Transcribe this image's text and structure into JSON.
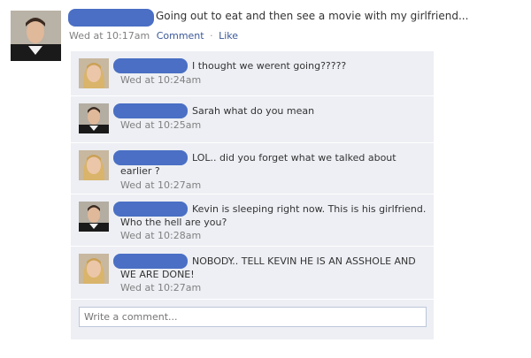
{
  "post": {
    "text": "Going out to eat and then see a movie with my girlfriend...",
    "timestamp": "Wed at 10:17am",
    "comment_link": "Comment",
    "separator": "·",
    "like_link": "Like"
  },
  "comments": [
    {
      "text": "I thought we werent going?????",
      "timestamp": "Wed at 10:24am"
    },
    {
      "text": "Sarah what do you mean",
      "timestamp": "Wed at 10:25am"
    },
    {
      "text": "LOL.. did you forget what we talked about earlier ?",
      "timestamp": "Wed at 10:27am"
    },
    {
      "text": "Kevin is sleeping right now. This is his girlfriend. Who the hell are you?",
      "timestamp": "Wed at 10:28am"
    },
    {
      "text": "NOBODY.. TELL KEVIN HE IS AN ASSHOLE AND WE ARE DONE!",
      "timestamp": "Wed at 10:27am"
    }
  ],
  "comment_input": {
    "placeholder": "Write a comment..."
  },
  "colors": {
    "link": "#3b5998",
    "redaction": "#4a6fc4",
    "comment_bg": "#edeff4",
    "timestamp": "#808080"
  }
}
